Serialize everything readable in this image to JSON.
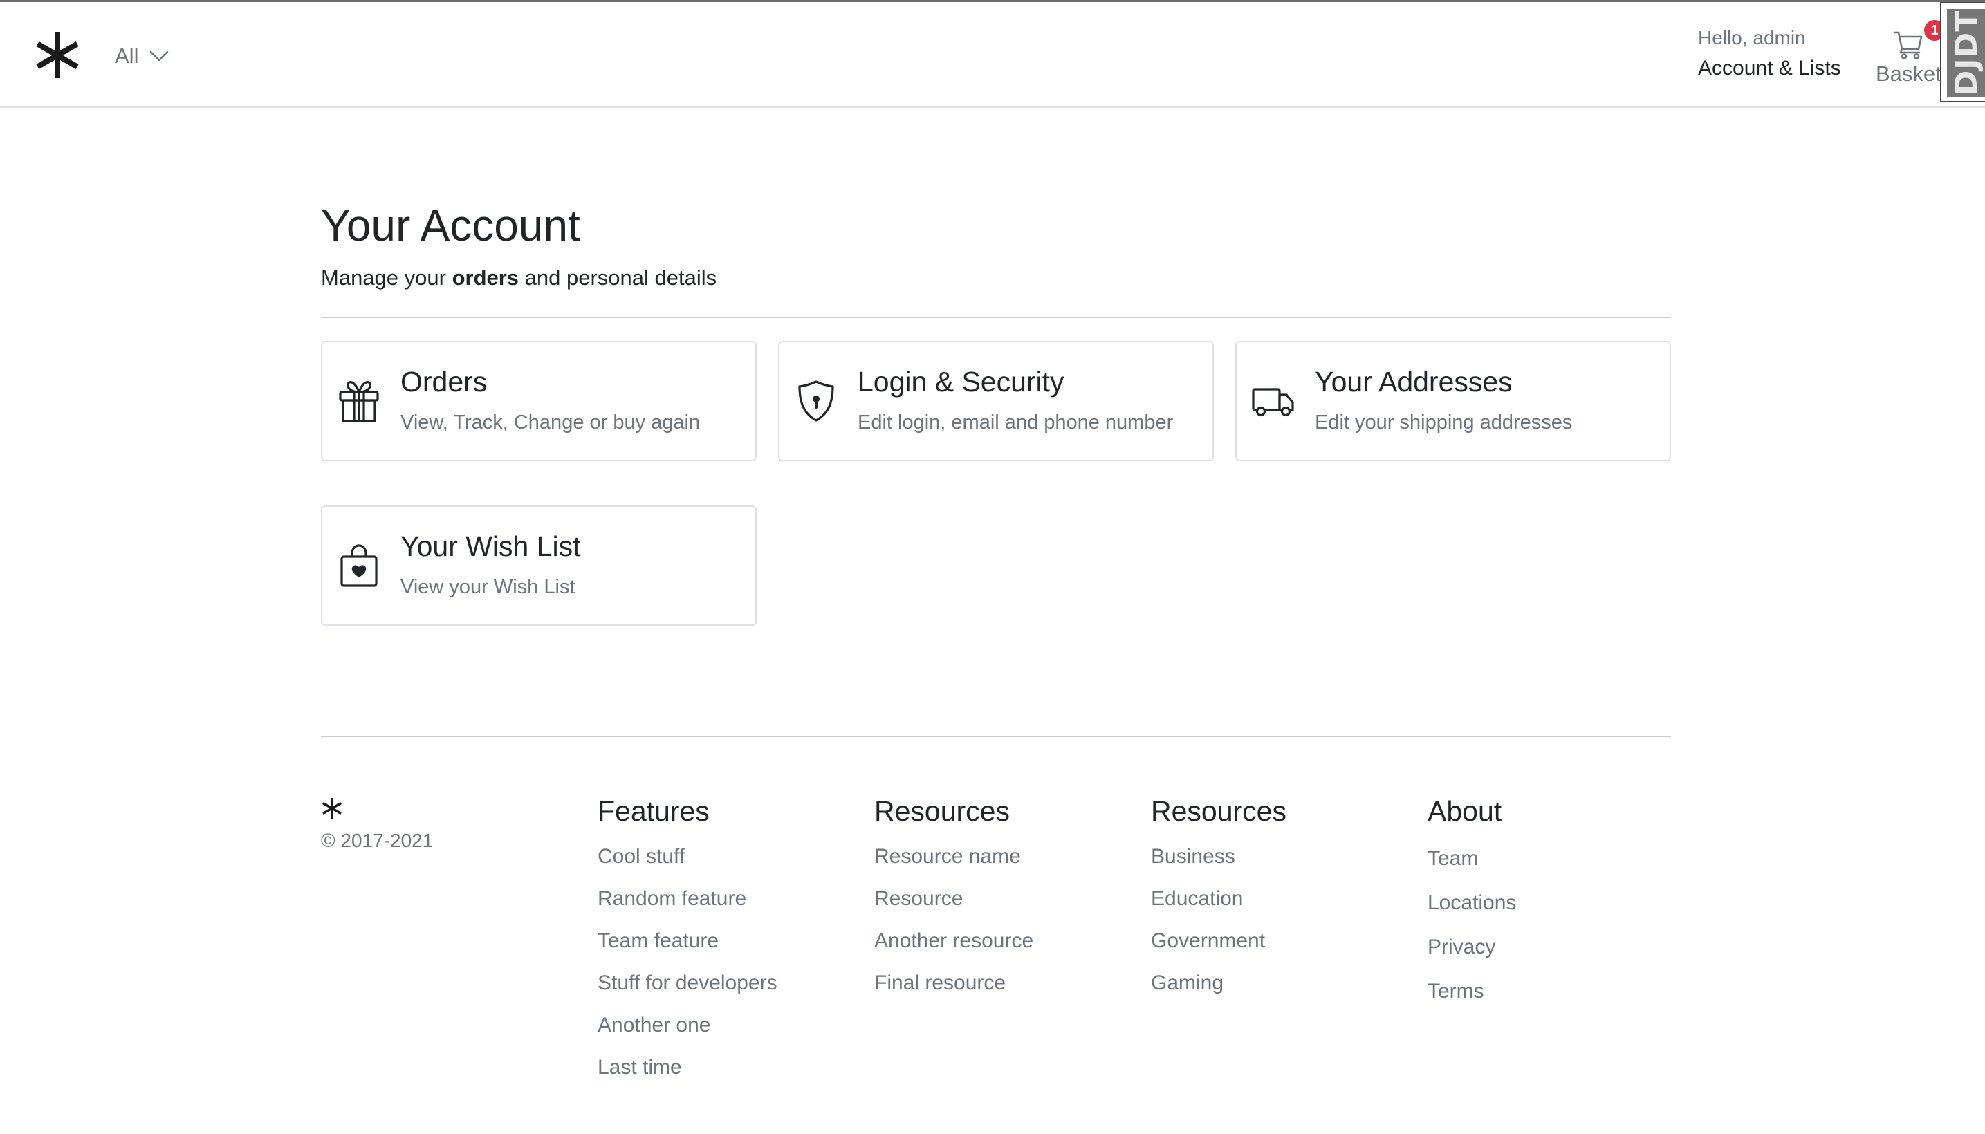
{
  "header": {
    "department_selector": "All",
    "greeting": "Hello, admin",
    "account_lists": "Account & Lists",
    "basket_label": "Basket",
    "basket_count": "1",
    "debug_toolbar_label": "DJDT"
  },
  "main": {
    "title": "Your Account",
    "subtitle_prefix": "Manage your ",
    "subtitle_bold": "orders",
    "subtitle_suffix": " and personal details",
    "cards": [
      {
        "title": "Orders",
        "subtitle": "View, Track, Change or buy again",
        "icon": "gift-icon"
      },
      {
        "title": "Login & Security",
        "subtitle": "Edit login, email and phone number",
        "icon": "shield-lock-icon"
      },
      {
        "title": "Your Addresses",
        "subtitle": "Edit your shipping addresses",
        "icon": "truck-icon"
      },
      {
        "title": "Your Wish List",
        "subtitle": "View your Wish List",
        "icon": "bag-heart-icon"
      }
    ]
  },
  "footer": {
    "copyright": "© 2017-2021",
    "columns": [
      {
        "heading": "Features",
        "links": [
          "Cool stuff",
          "Random feature",
          "Team feature",
          "Stuff for developers",
          "Another one",
          "Last time"
        ]
      },
      {
        "heading": "Resources",
        "links": [
          "Resource name",
          "Resource",
          "Another resource",
          "Final resource"
        ]
      },
      {
        "heading": "Resources",
        "links": [
          "Business",
          "Education",
          "Government",
          "Gaming"
        ]
      },
      {
        "heading": "About",
        "links": [
          "Team",
          "Locations",
          "Privacy",
          "Terms"
        ]
      }
    ]
  }
}
